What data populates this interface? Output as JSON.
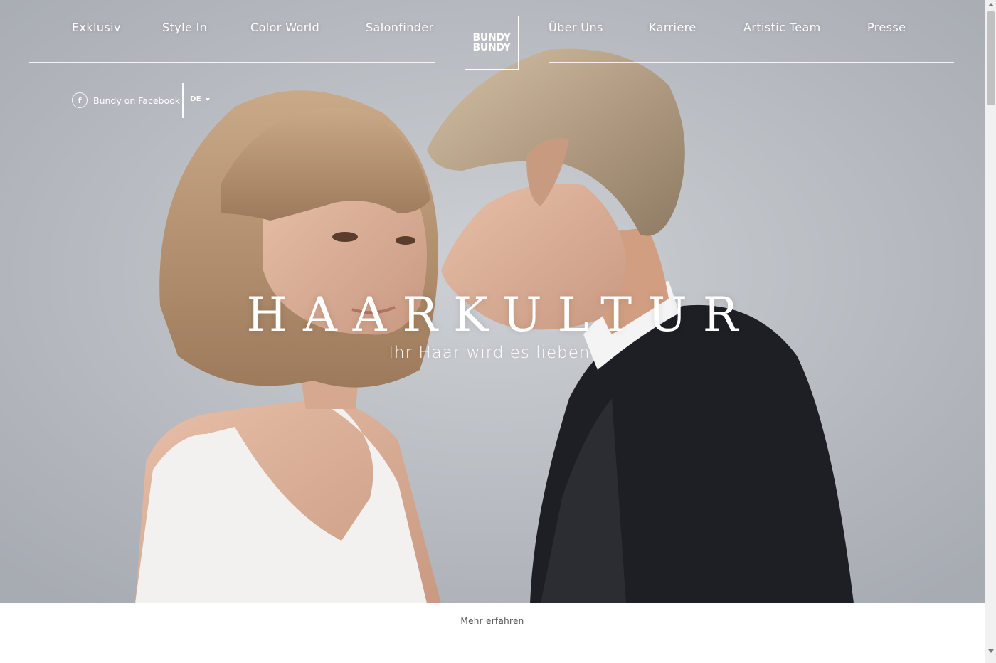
{
  "nav": {
    "left": [
      "Exklusiv",
      "Style In",
      "Color World",
      "Salonfinder"
    ],
    "right": [
      "Über Uns",
      "Karriere",
      "Artistic Team",
      "Presse"
    ]
  },
  "logo": {
    "line1": "BUNDY",
    "line2": "BUNDY"
  },
  "social": {
    "facebook_icon": "facebook-icon",
    "facebook_glyph": "f",
    "facebook_label": "Bundy on Facebook"
  },
  "language": {
    "current": "DE"
  },
  "hero": {
    "headline": "HAARKULTUR",
    "tagline": "Ihr Haar wird es lieben."
  },
  "more": {
    "label": "Mehr erfahren"
  },
  "colors": {
    "text": "#ffffff",
    "background": "#b8bbc1",
    "strip": "#ffffff",
    "muted": "#555555"
  }
}
